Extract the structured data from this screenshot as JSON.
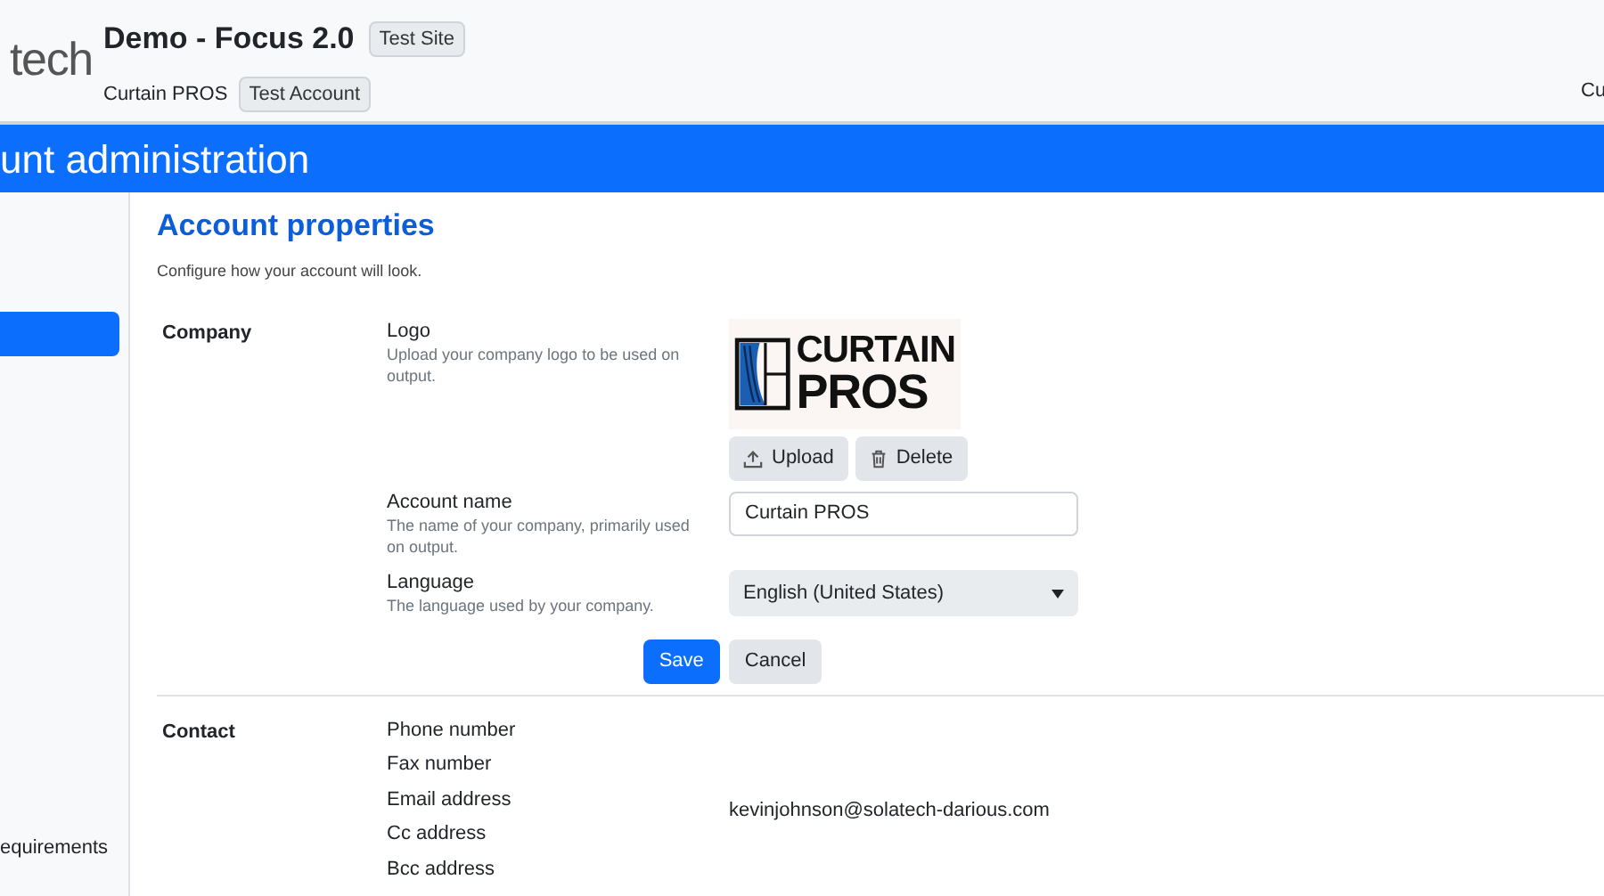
{
  "header": {
    "brand": "tech",
    "site_title": "Demo - Focus 2.0",
    "site_badge": "Test Site",
    "account_name": "Curtain PROS",
    "account_badge": "Test Account",
    "user": "Cu"
  },
  "page_bar": {
    "title": "unt administration"
  },
  "sidebar": {
    "items": [
      {
        "selected": true
      },
      {
        "label": "equirements",
        "selected": false
      }
    ]
  },
  "main": {
    "title": "Account properties",
    "subtitle": "Configure how your account will look.",
    "sections": [
      {
        "title": "Company",
        "fields": [
          {
            "kind": "logo",
            "label": "Logo",
            "help": "Upload your company logo to be used on output.",
            "logo_lines": [
              "CURTAIN",
              "PROS"
            ],
            "buttons": [
              "Upload",
              "Delete"
            ]
          },
          {
            "kind": "text",
            "label": "Account name",
            "help": "The name of your company, primarily used on output.",
            "value": "Curtain PROS"
          },
          {
            "kind": "select",
            "label": "Language",
            "help": "The language used by your company.",
            "value": "English (United States)"
          }
        ],
        "actions": [
          "Save",
          "Cancel"
        ]
      },
      {
        "title": "Contact",
        "fields": [
          {
            "kind": "static",
            "label": "Phone number"
          },
          {
            "kind": "static",
            "label": "Fax number"
          },
          {
            "kind": "static",
            "label": "Email address",
            "value": "kevinjohnson@solatech-darious.com"
          },
          {
            "kind": "static",
            "label": "Cc address"
          },
          {
            "kind": "static",
            "label": "Bcc address"
          }
        ]
      }
    ]
  }
}
